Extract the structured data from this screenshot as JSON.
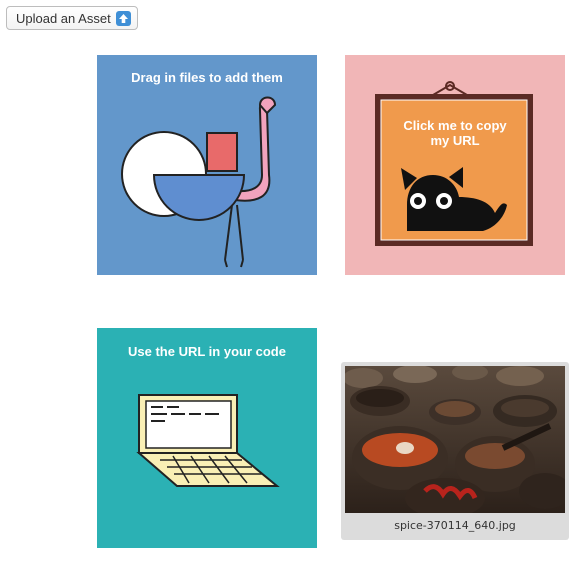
{
  "toolbar": {
    "upload_label": "Upload an Asset",
    "upload_icon": "upload-arrow-icon"
  },
  "cards": [
    {
      "title": "Drag in files to add them",
      "illustration": "ostrich-shapes",
      "color": "#6397cb"
    },
    {
      "title_lines": [
        "Click me to copy",
        "my URL"
      ],
      "illustration": "cat-in-frame",
      "color": "#f1b6b7"
    },
    {
      "title": "Use the URL in your code",
      "illustration": "laptop",
      "color": "#2bb1b4"
    }
  ],
  "assets": [
    {
      "filename": "spice-370114_640.jpg",
      "thumbnail": "spice-bowls-photo"
    }
  ],
  "colors": {
    "accent": "#3f8fd6",
    "frame_orange": "#f09a4c",
    "asset_tile_bg": "#dcdcdc"
  }
}
